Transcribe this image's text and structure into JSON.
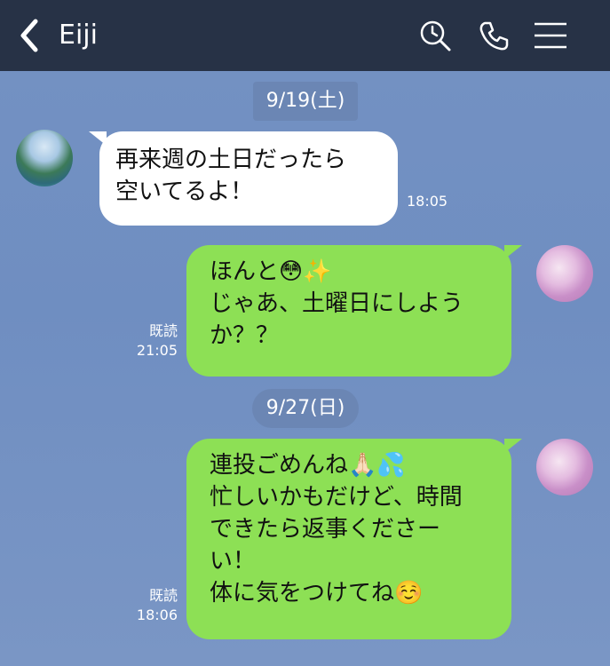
{
  "header": {
    "title": "Eiji",
    "back_icon": "back-chevron-icon",
    "search_icon": "search-icon",
    "call_icon": "phone-icon",
    "menu_icon": "menu-icon",
    "background": "#273246"
  },
  "chat": {
    "background": "#7391c2",
    "dates": [
      "9/19(土)",
      "9/27(日)"
    ],
    "messages": [
      {
        "side": "incoming",
        "lines": [
          "再来週の土日だったら",
          "空いてるよ！"
        ],
        "time": "18:05"
      },
      {
        "side": "outgoing",
        "lines": [
          "ほんと😳✨",
          "じゃあ、土曜日にしよう",
          "か？？"
        ],
        "read": "既読",
        "time": "21:05"
      },
      {
        "side": "outgoing",
        "lines": [
          "連投ごめんね🙏🏻💦",
          "忙しいかもだけど、時間",
          "できたら返事くださー",
          "い！",
          "体に気をつけてね☺️"
        ],
        "read": "既読",
        "time": "18:06"
      }
    ],
    "colors": {
      "incoming_bubble": "#ffffff",
      "outgoing_bubble": "#8de055"
    }
  }
}
